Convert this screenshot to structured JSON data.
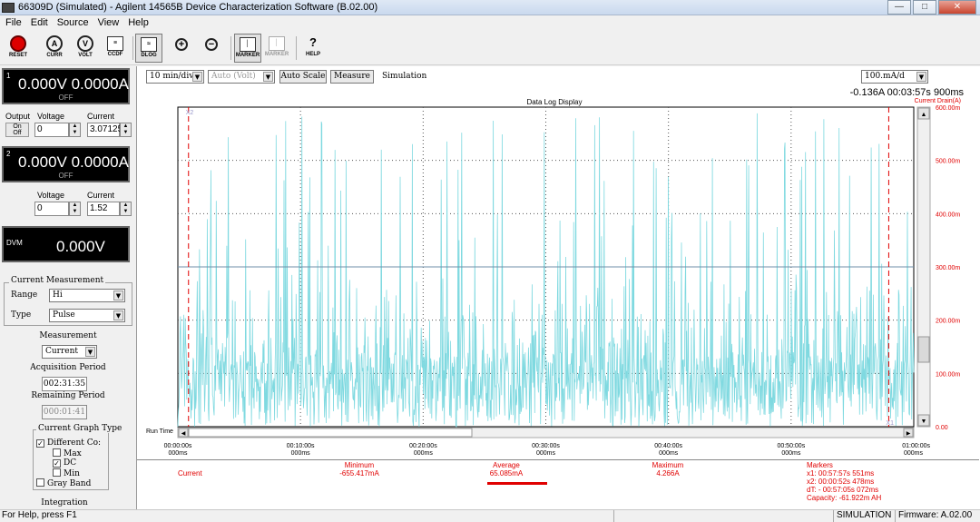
{
  "window": {
    "title": "66309D (Simulated) - Agilent 14565B Device Characterization Software (B.02.00)",
    "minimize": "—",
    "maximize": "□",
    "close": "✕"
  },
  "menu": [
    "File",
    "Edit",
    "Source",
    "View",
    "Help"
  ],
  "toolbar": {
    "buttons": [
      {
        "label": "RESET",
        "icon": "●"
      },
      {
        "label": "CURR",
        "icon": "A"
      },
      {
        "label": "VOLT",
        "icon": "V"
      },
      {
        "label": "CCDF",
        "icon": "≡"
      },
      {
        "label": "DLOG",
        "icon": "≈"
      },
      {
        "label": "",
        "icon": "+"
      },
      {
        "label": "",
        "icon": "−"
      },
      {
        "label": "MARKER",
        "icon": "│"
      },
      {
        "label": "MARKER",
        "icon": "│"
      },
      {
        "label": "HELP",
        "icon": "?"
      }
    ]
  },
  "channel1": {
    "index": "1",
    "reading": "0.000V 0.0000A",
    "state": "OFF",
    "output_label": "Output",
    "on_label": "On",
    "off_label": "Off",
    "voltage_label": "Voltage",
    "current_label": "Current",
    "voltage_value": "0",
    "current_value": "3.07125"
  },
  "channel2": {
    "index": "2",
    "reading": "0.000V 0.0000A",
    "state": "OFF",
    "voltage_label": "Voltage",
    "current_label": "Current",
    "voltage_value": "0",
    "current_value": "1.52"
  },
  "dvm": {
    "label": "DVM",
    "reading": "0.000V"
  },
  "current_measurement": {
    "title": "Current Measurement",
    "range_label": "Range",
    "range_value": "Hi",
    "type_label": "Type",
    "type_value": "Pulse"
  },
  "measurement": {
    "title": "Measurement",
    "value": "Current",
    "acq_label": "Acquisition Period",
    "acq_value": "002:31:35",
    "remaining_label": "Remaining Period",
    "remaining_value": "000:01:41"
  },
  "graph_type": {
    "title": "Current Graph Type",
    "different": "Different Co:",
    "max": "Max",
    "dc": "DC",
    "min": "Min",
    "gray": "Gray Band"
  },
  "integration_label": "Integration",
  "options": {
    "timebase": "10 min/div",
    "auto_volt": "Auto (Volt)",
    "auto_scale": "Auto Scale",
    "measure": "Measure",
    "mode": "Simulation",
    "scale": "100.mA/d"
  },
  "readout": "-0.136A  00:03:57s 900ms",
  "chart_data": {
    "type": "line",
    "title": "Data Log Display",
    "ylabel": "Current Drain(A)",
    "xlabel": "Run Time",
    "ylim": [
      0,
      600
    ],
    "y_unit": "mA",
    "y_ticks": [
      "600.00m",
      "500.00m",
      "400.00m",
      "300.00m",
      "200.00m",
      "100.00m",
      "0.00"
    ],
    "x_ticks": [
      [
        "00:00:00s",
        "000ms"
      ],
      [
        "00:10:00s",
        "000ms"
      ],
      [
        "00:20:00s",
        "000ms"
      ],
      [
        "00:30:00s",
        "000ms"
      ],
      [
        "00:40:00s",
        "000ms"
      ],
      [
        "00:50:00s",
        "000ms"
      ],
      [
        "01:00:00s",
        "000ms"
      ]
    ],
    "x_range_minutes": [
      0,
      60
    ],
    "marker_x2_label": "X2",
    "marker_x1_label": "X1",
    "marker_x2_minutes": 0.87,
    "marker_x1_minutes": 57.96,
    "reference_line_mA": 300,
    "series_color": "#7fd9e0",
    "marker_color": "#e00000"
  },
  "summary": {
    "row_label": "Current",
    "minimum_label": "Minimum",
    "minimum_value": "-655.417mA",
    "average_label": "Average",
    "average_value": "65.085mA",
    "maximum_label": "Maximum",
    "maximum_value": "4.266A",
    "markers_label": "Markers",
    "x1": "x1:  00:57:57s 551ms",
    "x2": "x2:  00:00:52s 478ms",
    "dt": "dT:  - 00:57:05s 072ms",
    "capacity": "Capacity:  -61.922m AH"
  },
  "status": {
    "help": "For Help, press F1",
    "mode": "SIMULATION",
    "firmware": "Firmware: A.02.00"
  }
}
